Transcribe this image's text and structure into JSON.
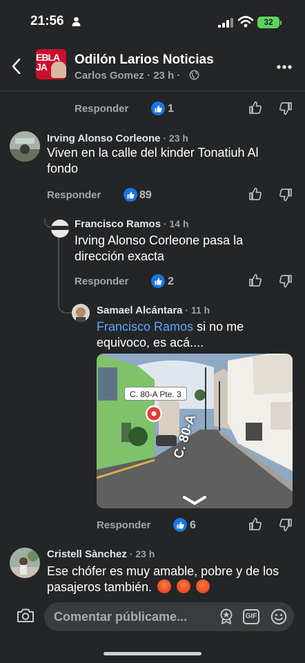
{
  "status": {
    "time": "21:56",
    "battery": "32"
  },
  "header": {
    "page_name": "Odilón Larios Noticias",
    "author": "Carlos Gomez",
    "age": "23 h",
    "avatar_text": "EBLA\nJA"
  },
  "top_actions": {
    "reply": "Responder",
    "likes": "1"
  },
  "comments": [
    {
      "author": "Irving Alonso Corleone",
      "age": "23 h",
      "text": "Viven en la calle del kinder Tonatiuh Al fondo",
      "reply": "Responder",
      "likes": "89"
    },
    {
      "author": "Francisco Ramos",
      "age": "14 h",
      "text": "Irving Alonso Corleone pasa la dirección exacta",
      "reply": "Responder",
      "likes": "2"
    },
    {
      "author": "Samael Alcántara",
      "age": "11 h",
      "mention": "Francisco Ramos",
      "text": "si no me equivoco, es acá....",
      "reply": "Responder",
      "likes": "6",
      "map_label": "C. 80-A Pte. 3",
      "map_street": "C. 80-A"
    },
    {
      "author": "Cristell Sànchez",
      "age": "23 h",
      "text": "Ese chófer es muy amable, pobre y de los pasajeros también."
    }
  ],
  "composer": {
    "placeholder": "Comentar públicame...",
    "gif": "GIF"
  },
  "colors": {
    "background": "#232527",
    "like_blue": "#1b74e4",
    "mention": "#5aa7ff",
    "battery": "#5cd35b"
  },
  "icons": [
    "person-icon",
    "signal-icon",
    "wifi-icon",
    "back-icon",
    "globe-icon",
    "more-icon",
    "thumb-up-icon",
    "thumb-down-icon",
    "camera-icon",
    "sticker-icon",
    "gif-icon",
    "emoji-icon",
    "map-pin-icon",
    "chevron-down-icon",
    "angry-emoji-icon"
  ]
}
